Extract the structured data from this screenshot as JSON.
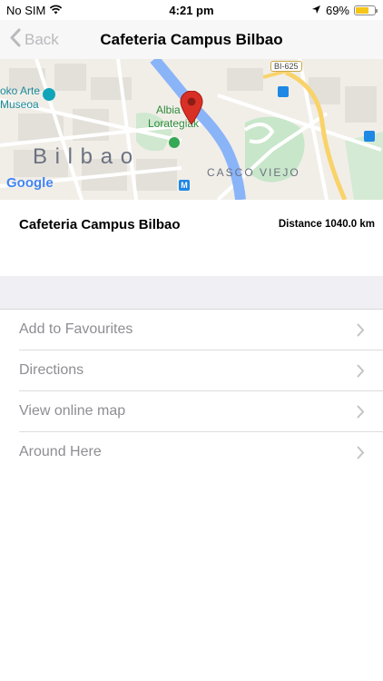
{
  "status_bar": {
    "carrier": "No SIM",
    "time": "4:21 pm",
    "battery_percent": "69%",
    "battery_level": 0.69,
    "battery_color": "#f5c518",
    "icons": [
      "wifi-icon",
      "location-arrow-icon",
      "battery-icon"
    ]
  },
  "nav": {
    "back_label": "Back",
    "title": "Cafeteria Campus Bilbao"
  },
  "map": {
    "labels": {
      "road_sign": "BI-625",
      "museum_line1": "oko Arte",
      "museum_line2": "Museoa",
      "garden_line1": "Albia",
      "garden_line2": "Lorategiak",
      "city": "B i l b a o",
      "district": "CASCO VIEJO",
      "google": "Google"
    },
    "colors": {
      "river": "#8ab4f8",
      "park": "#c8e6c9",
      "highway": "#f9d36a",
      "pin": "#d93025"
    }
  },
  "info": {
    "place_name": "Cafeteria Campus Bilbao",
    "distance": "Distance 1040.0 km"
  },
  "menu": {
    "items": [
      {
        "label": "Add to Favourites"
      },
      {
        "label": "Directions"
      },
      {
        "label": "View online map"
      },
      {
        "label": "Around Here"
      }
    ]
  }
}
